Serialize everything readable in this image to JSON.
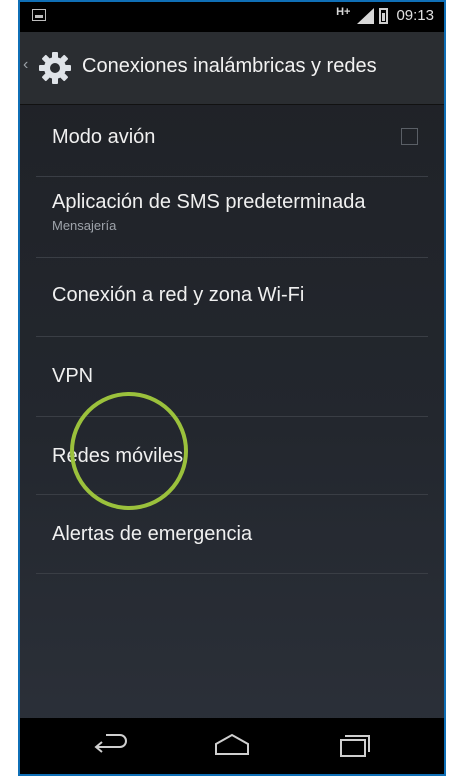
{
  "status_bar": {
    "network": "H+",
    "time": "09:13"
  },
  "action_bar": {
    "title": "Conexiones inalámbricas y redes",
    "icon": "settings-gear-icon"
  },
  "settings": {
    "items": [
      {
        "label": "Modo avión",
        "checked": false
      },
      {
        "label": "Aplicación de SMS predeterminada",
        "sublabel": "Mensajería"
      },
      {
        "label": "Conexión a red y zona Wi-Fi"
      },
      {
        "label": "VPN"
      },
      {
        "label": "Redes móviles"
      },
      {
        "label": "Alertas de emergencia"
      }
    ]
  },
  "highlight": {
    "color": "#9bc13c",
    "target": "Redes móviles"
  },
  "navigation": {
    "buttons": [
      "back-icon",
      "home-icon",
      "recent-apps-icon"
    ]
  },
  "colors": {
    "frame": "#0f6fb6",
    "background": "#23272e",
    "text": "#f0f0f0"
  }
}
